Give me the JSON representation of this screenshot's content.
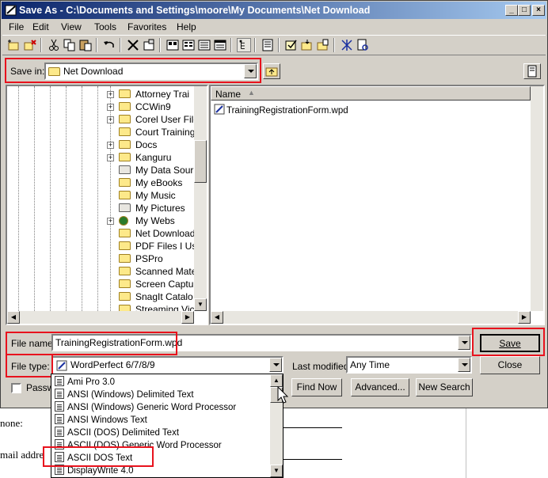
{
  "window": {
    "title": "Save As - C:\\Documents and Settings\\moore\\My Documents\\Net Download",
    "minimize": "_",
    "maximize": "□",
    "close": "×"
  },
  "menu": [
    "File",
    "Edit",
    "View",
    "Tools",
    "Favorites",
    "Help"
  ],
  "toolbar_icons": [
    "new-folder-icon",
    "delete-icon",
    "cut-icon",
    "copy-icon",
    "paste-icon",
    "undo-icon",
    "delete-x-icon",
    "properties-icon",
    "large-icons-view-icon",
    "small-icons-view-icon",
    "list-view-icon",
    "details-view-icon",
    "tree-view-icon",
    "preview-icon",
    "select-all-icon",
    "open-folder-icon",
    "send-to-icon",
    "map-drive-icon",
    "quickfinder-icon"
  ],
  "save_in": {
    "label": "Save in:",
    "value": "Net Download"
  },
  "tree": {
    "items": [
      {
        "label": "Attorney Trai",
        "expandable": true,
        "icon": "folder"
      },
      {
        "label": "CCWin9",
        "expandable": true,
        "icon": "folder"
      },
      {
        "label": "Corel User File",
        "expandable": true,
        "icon": "folder"
      },
      {
        "label": "Court Training",
        "expandable": false,
        "icon": "folder"
      },
      {
        "label": "Docs",
        "expandable": true,
        "icon": "folder"
      },
      {
        "label": "Kanguru",
        "expandable": true,
        "icon": "folder"
      },
      {
        "label": "My Data Sour",
        "expandable": false,
        "icon": "data-folder"
      },
      {
        "label": "My eBooks",
        "expandable": false,
        "icon": "folder"
      },
      {
        "label": "My Music",
        "expandable": false,
        "icon": "folder"
      },
      {
        "label": "My Pictures",
        "expandable": false,
        "icon": "pictures-folder"
      },
      {
        "label": "My Webs",
        "expandable": true,
        "icon": "web-folder"
      },
      {
        "label": "Net Download",
        "expandable": false,
        "icon": "folder"
      },
      {
        "label": "PDF Files I Us",
        "expandable": false,
        "icon": "folder"
      },
      {
        "label": "PSPro",
        "expandable": false,
        "icon": "folder"
      },
      {
        "label": "Scanned Mate",
        "expandable": false,
        "icon": "folder"
      },
      {
        "label": "Screen Captu",
        "expandable": false,
        "icon": "folder"
      },
      {
        "label": "SnagIt Catalo",
        "expandable": false,
        "icon": "folder"
      },
      {
        "label": "Streaming Vic",
        "expandable": false,
        "icon": "folder"
      }
    ]
  },
  "list": {
    "column_name": "Name",
    "files": [
      "TrainingRegistrationForm.wpd"
    ]
  },
  "file_name": {
    "label": "File name:",
    "value": "TrainingRegistrationForm.wpd"
  },
  "file_type": {
    "label": "File type:",
    "value": "WordPerfect 6/7/8/9"
  },
  "last_modified": {
    "label": "Last modified:",
    "value": "Any Time"
  },
  "password_label": "Passw",
  "buttons": {
    "save": "Save",
    "close": "Close",
    "find_now": "Find Now",
    "advanced": "Advanced...",
    "new_search": "New Search"
  },
  "file_type_options": [
    "Ami Pro 3.0",
    "ANSI (Windows) Delimited Text",
    "ANSI (Windows) Generic Word Processor",
    "ANSI Windows Text",
    "ASCII (DOS) Delimited Text",
    "ASCII (DOS) Generic Word Processor",
    "ASCII DOS Text",
    "DisplayWrite 4.0"
  ],
  "background_doc": {
    "line1": "none:",
    "line2": "mail addre"
  },
  "colors": {
    "highlight": "#e8121d",
    "titlebar_start": "#0a246a",
    "titlebar_end": "#a6caf0",
    "face": "#d4d0c8"
  }
}
